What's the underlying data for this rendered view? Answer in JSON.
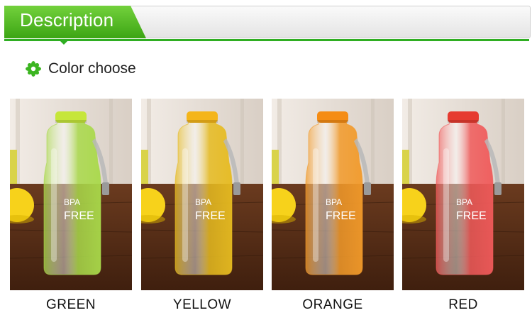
{
  "header": {
    "title": "Description"
  },
  "section": {
    "label": "Color choose",
    "icon": "flower-icon"
  },
  "products": [
    {
      "label": "GREEN",
      "tint": "#a9d94a",
      "cap": "#c6e63a",
      "print": [
        "BPA",
        "FREE"
      ]
    },
    {
      "label": "YELLOW",
      "tint": "#e6bb20",
      "cap": "#f4b51a",
      "print": [
        "BPA",
        "FREE"
      ]
    },
    {
      "label": "ORANGE",
      "tint": "#f29a2a",
      "cap": "#f58c14",
      "print": [
        "BPA",
        "FREE"
      ]
    },
    {
      "label": "RED",
      "tint": "#f05a5a",
      "cap": "#e63b30",
      "print": [
        "BPA",
        "FREE"
      ]
    }
  ],
  "colors": {
    "accent": "#3ca514",
    "rule": "#2fae22"
  }
}
